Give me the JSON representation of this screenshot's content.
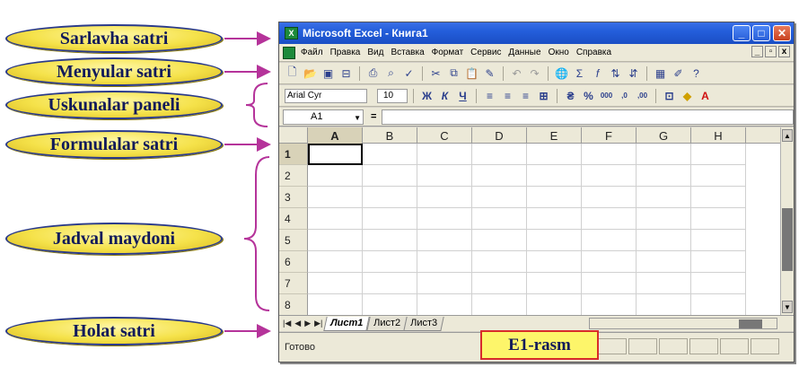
{
  "labels": {
    "title_bar": "Sarlavha satri",
    "menu_bar": "Menyular satri",
    "toolbar": "Uskunalar paneli",
    "formula_bar": "Formulalar satri",
    "table_area": "Jadval maydoni",
    "status_bar": "Holat satri"
  },
  "window": {
    "title": "Microsoft Excel - Книга1",
    "menus": [
      "Файл",
      "Правка",
      "Вид",
      "Вставка",
      "Формат",
      "Сервис",
      "Данные",
      "Окно",
      "Справка"
    ]
  },
  "toolbar": {
    "icons": [
      "new-icon",
      "open-icon",
      "save-icon",
      "permission-icon",
      "print-icon",
      "print-preview-icon",
      "spelling-icon",
      "cut-icon",
      "copy-icon",
      "paste-icon",
      "format-painter-icon",
      "undo-icon",
      "redo-icon",
      "hyperlink-icon",
      "autosum-icon",
      "function-icon",
      "sort-ascending-icon",
      "sort-descending-icon",
      "chart-wizard-icon",
      "drawing-icon",
      "help-icon"
    ]
  },
  "format_bar": {
    "font": "Arial Cyr",
    "size": "10"
  },
  "formula_bar": {
    "name_box": "A1",
    "eq": "="
  },
  "grid": {
    "columns": [
      "A",
      "B",
      "C",
      "D",
      "E",
      "F",
      "G",
      "H"
    ],
    "rows": [
      "1",
      "2",
      "3",
      "4",
      "5",
      "6",
      "7",
      "8"
    ],
    "active_cell": "A1"
  },
  "sheets": {
    "tabs": [
      "Лист1",
      "Лист2",
      "Лист3"
    ],
    "active": "Лист1"
  },
  "status": {
    "text": "Готово"
  },
  "caption": "E1-rasm",
  "colors": {
    "label_fill": "#f5e24a",
    "connector": "#b5339a",
    "caption_border": "#d82b2b",
    "titlebar": "#245edb"
  }
}
